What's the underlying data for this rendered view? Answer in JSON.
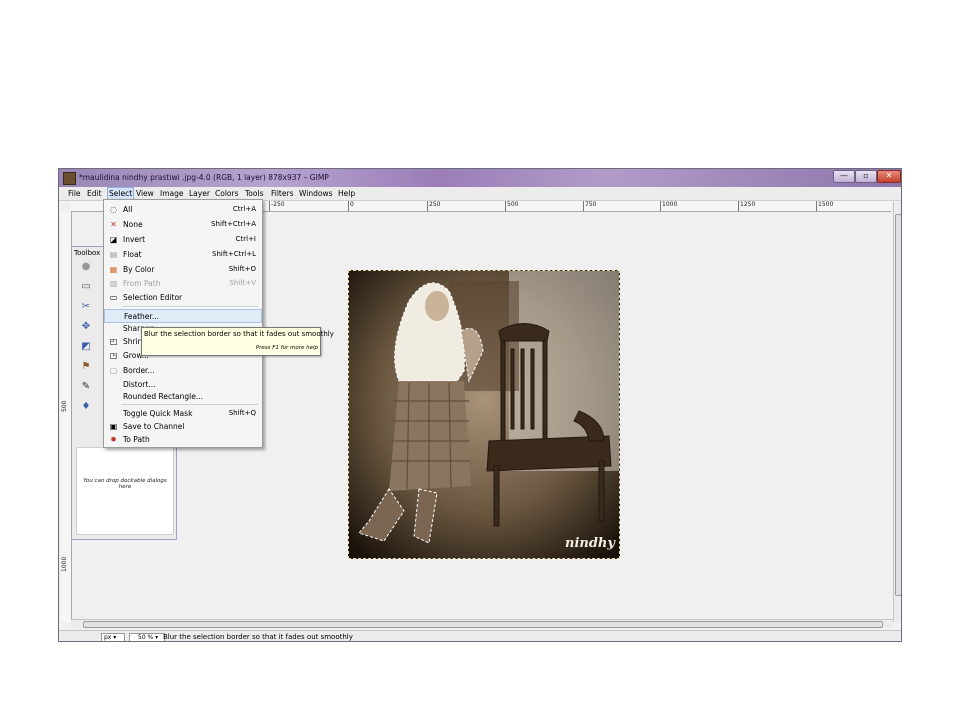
{
  "window": {
    "title": "*maulidina nindhy prastiwi .jpg-4.0 (RGB, 1 layer) 878x937 – GIMP",
    "min_label": "—",
    "max_label": "▫",
    "close_label": "✕"
  },
  "menubar": {
    "items": [
      "File",
      "Edit",
      "Select",
      "View",
      "Image",
      "Layer",
      "Colors",
      "Tools",
      "Filters",
      "Windows",
      "Help"
    ]
  },
  "ruler": {
    "h_labels": [
      "-250",
      "0",
      "250",
      "500",
      "750",
      "1000",
      "1250",
      "1500"
    ],
    "v_labels": [
      "500",
      "1000"
    ]
  },
  "canvas": {
    "watermark": "nindhy"
  },
  "toolbox": {
    "title": "Toolbox",
    "drop_text": "You can drop dockable dialogs here"
  },
  "select_menu": {
    "items": [
      {
        "label": "All",
        "shortcut": "Ctrl+A",
        "icon": "◌"
      },
      {
        "label": "None",
        "shortcut": "Shift+Ctrl+A",
        "icon": "✕"
      },
      {
        "label": "Invert",
        "shortcut": "Ctrl+I",
        "icon": "◪"
      },
      {
        "label": "Float",
        "shortcut": "Shift+Ctrl+L",
        "icon": "▤"
      },
      {
        "label": "By Color",
        "shortcut": "Shift+O",
        "icon": "▦"
      },
      {
        "label": "From Path",
        "shortcut": "Shift+V",
        "icon": "▨"
      },
      {
        "label": "Selection Editor",
        "shortcut": "",
        "icon": "▭"
      },
      {
        "label": "Feather...",
        "shortcut": "",
        "icon": ""
      },
      {
        "label": "Sharpen",
        "shortcut": "",
        "icon": ""
      },
      {
        "label": "Shrink...",
        "shortcut": "",
        "icon": "◰"
      },
      {
        "label": "Grow...",
        "shortcut": "",
        "icon": "◳"
      },
      {
        "label": "Border...",
        "shortcut": "",
        "icon": "▢"
      },
      {
        "label": "Distort...",
        "shortcut": "",
        "icon": ""
      },
      {
        "label": "Rounded Rectangle...",
        "shortcut": "",
        "icon": ""
      },
      {
        "label": "Toggle Quick Mask",
        "shortcut": "Shift+Q",
        "icon": ""
      },
      {
        "label": "Save to Channel",
        "shortcut": "",
        "icon": "▣"
      },
      {
        "label": "To Path",
        "shortcut": "",
        "icon": "✸"
      }
    ]
  },
  "tooltip": {
    "text": "Blur the selection border so that it fades out smoothly",
    "hint": "Press F1 for more help"
  },
  "statusbar": {
    "unit": "px ▾",
    "zoom": "50 % ▾",
    "message": "Blur the selection border so that it fades out smoothly"
  }
}
